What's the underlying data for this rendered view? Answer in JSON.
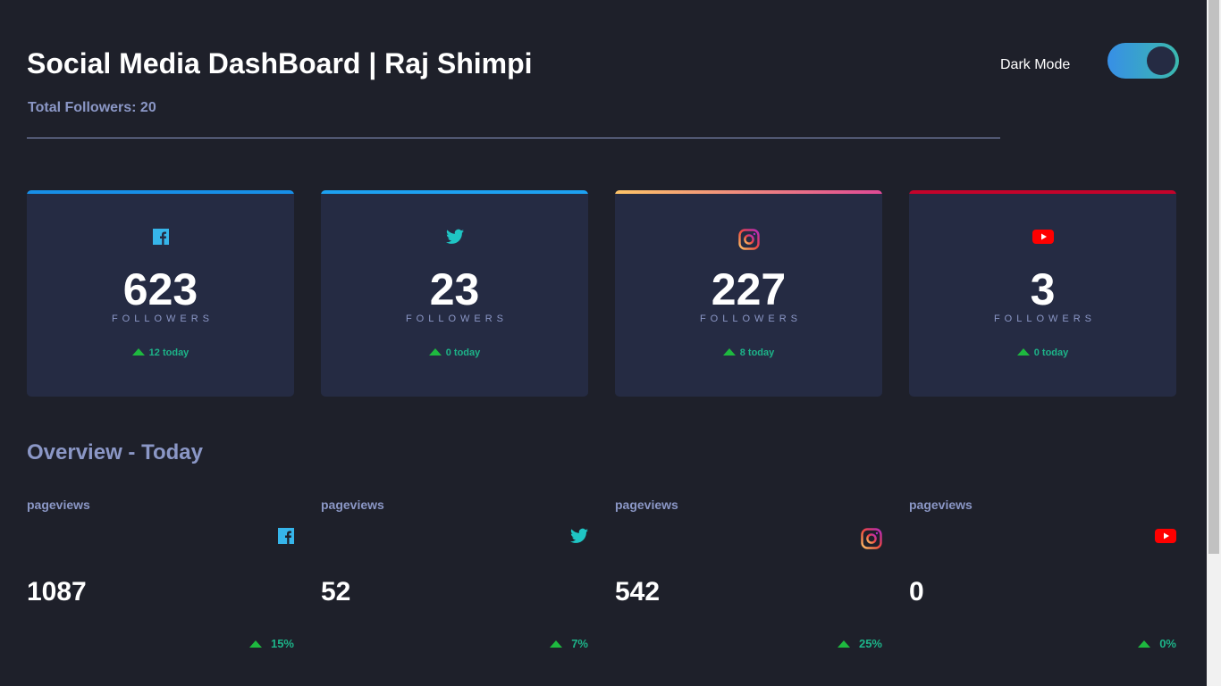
{
  "header": {
    "title": "Social Media DashBoard | Raj Shimpi",
    "total_followers": "Total Followers: 20",
    "dark_mode_label": "Dark Mode",
    "dark_mode_on": true
  },
  "colors": {
    "facebook": "#1877f2",
    "twitter": "#1da1f2",
    "instagram": "linear-gradient(90deg,#fdc468,#df4996)",
    "youtube": "#c4032b",
    "up": "#1db489"
  },
  "cards": [
    {
      "platform": "facebook",
      "icon": "facebook-icon",
      "count": "623",
      "label": "FOLLOWERS",
      "today": "12 today"
    },
    {
      "platform": "twitter",
      "icon": "twitter-icon",
      "count": "23",
      "label": "FOLLOWERS",
      "today": "0 today"
    },
    {
      "platform": "instagram",
      "icon": "instagram-icon",
      "count": "227",
      "label": "FOLLOWERS",
      "today": "8 today"
    },
    {
      "platform": "youtube",
      "icon": "youtube-icon",
      "count": "3",
      "label": "FOLLOWERS",
      "today": "0 today"
    }
  ],
  "overview": {
    "title": "Overview - Today",
    "items": [
      {
        "platform": "facebook",
        "label": "pageviews",
        "value": "1087",
        "change": "15%"
      },
      {
        "platform": "twitter",
        "label": "pageviews",
        "value": "52",
        "change": "7%"
      },
      {
        "platform": "instagram",
        "label": "pageviews",
        "value": "542",
        "change": "25%"
      },
      {
        "platform": "youtube",
        "label": "pageviews",
        "value": "0",
        "change": "0%"
      }
    ]
  }
}
